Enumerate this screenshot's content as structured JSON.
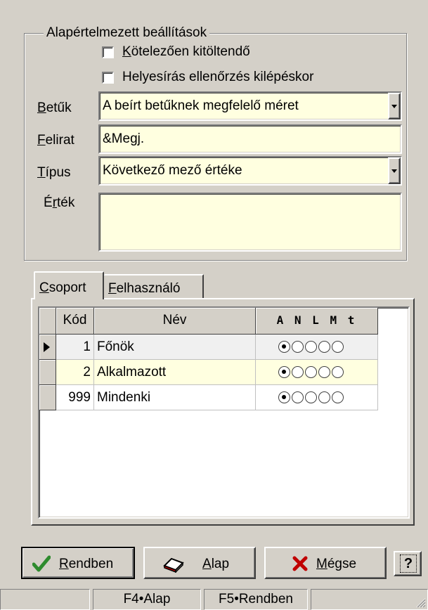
{
  "group": {
    "title": "Alapértelmezett beállítások",
    "checkbox_required": "Kötelezően kitöltendő",
    "checkbox_spellcheck": "Helyesírás ellenőrzés kilépéskor",
    "fields": {
      "betuk_label": "Betűk",
      "betuk_value": "A beírt betűknek megfelelő méret",
      "felirat_label": "Felirat",
      "felirat_value": "&Megj.",
      "tipus_label": "Típus",
      "tipus_value": "Következő  mező értéke",
      "ertek_label": "Érték",
      "ertek_value": ""
    }
  },
  "tabs": {
    "csoport": "Csoport",
    "felhasznalo": "Felhasználó"
  },
  "grid": {
    "headers": {
      "kod": "Kód",
      "nev": "Név",
      "flags": "A N L M t"
    },
    "rows": [
      {
        "kod": "1",
        "nev": "Főnök",
        "selected_radio": 0
      },
      {
        "kod": "2",
        "nev": "Alkalmazott",
        "selected_radio": 0
      },
      {
        "kod": "999",
        "nev": "Mindenki",
        "selected_radio": 0
      }
    ]
  },
  "buttons": {
    "ok": "Rendben",
    "base": "Alap",
    "cancel": "Mégse",
    "help": "?"
  },
  "status": {
    "f4": "F4•Alap",
    "f5": "F5•Rendben"
  },
  "colors": {
    "window_bg": "#d4d0c8",
    "field_bg": "#ffffe0",
    "ok_check": "#2e8b2e",
    "cancel_x": "#c00000"
  }
}
